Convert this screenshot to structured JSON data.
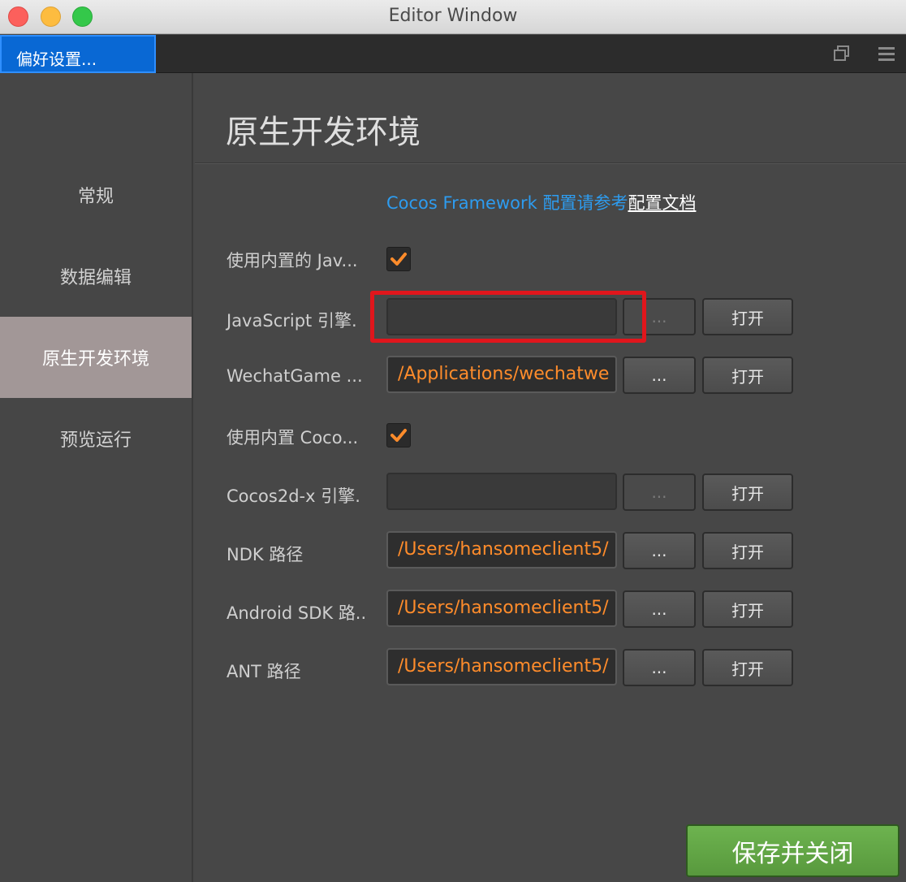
{
  "window": {
    "title": "Editor Window"
  },
  "tab": {
    "label": "偏好设置..."
  },
  "tab_icons": [
    "restore-icon",
    "menu-icon"
  ],
  "sidebar": {
    "items": [
      {
        "label": "常规",
        "active": false
      },
      {
        "label": "数据编辑",
        "active": false
      },
      {
        "label": "原生开发环境",
        "active": true
      },
      {
        "label": "预览运行",
        "active": false
      }
    ]
  },
  "main": {
    "title": "原生开发环境",
    "doc_text": "Cocos Framework 配置请参考",
    "doc_link": "配置文档",
    "rows": [
      {
        "label": "使用内置的 Jav...",
        "type": "checkbox",
        "checked": true
      },
      {
        "label": "JavaScript 引擎.",
        "type": "path",
        "value": "",
        "dots": "...",
        "open": "打开",
        "disabled": true
      },
      {
        "label": "WechatGame ...",
        "type": "path",
        "value": "/Applications/wechatwe",
        "dots": "...",
        "open": "打开",
        "disabled": false
      },
      {
        "label": "使用内置 Coco...",
        "type": "checkbox",
        "checked": true
      },
      {
        "label": "Cocos2d-x 引擎.",
        "type": "path",
        "value": "",
        "dots": "...",
        "open": "打开",
        "disabled": true
      },
      {
        "label": "NDK 路径",
        "type": "path",
        "value": "/Users/hansomeclient5/",
        "dots": "...",
        "open": "打开",
        "disabled": false
      },
      {
        "label": "Android SDK 路..",
        "type": "path",
        "value": "/Users/hansomeclient5/",
        "dots": "...",
        "open": "打开",
        "disabled": false
      },
      {
        "label": "ANT 路径",
        "type": "path",
        "value": "/Users/hansomeclient5/",
        "dots": "...",
        "open": "打开",
        "disabled": false
      }
    ],
    "save_button": "保存并关闭"
  },
  "colors": {
    "accent": "#0968d4",
    "link": "#2d9cf0",
    "path_text": "#ff8c2b",
    "check": "#ff8c2b",
    "save": "#62a646",
    "highlight": "#e0161c",
    "sidebar_active": "#a29797"
  }
}
